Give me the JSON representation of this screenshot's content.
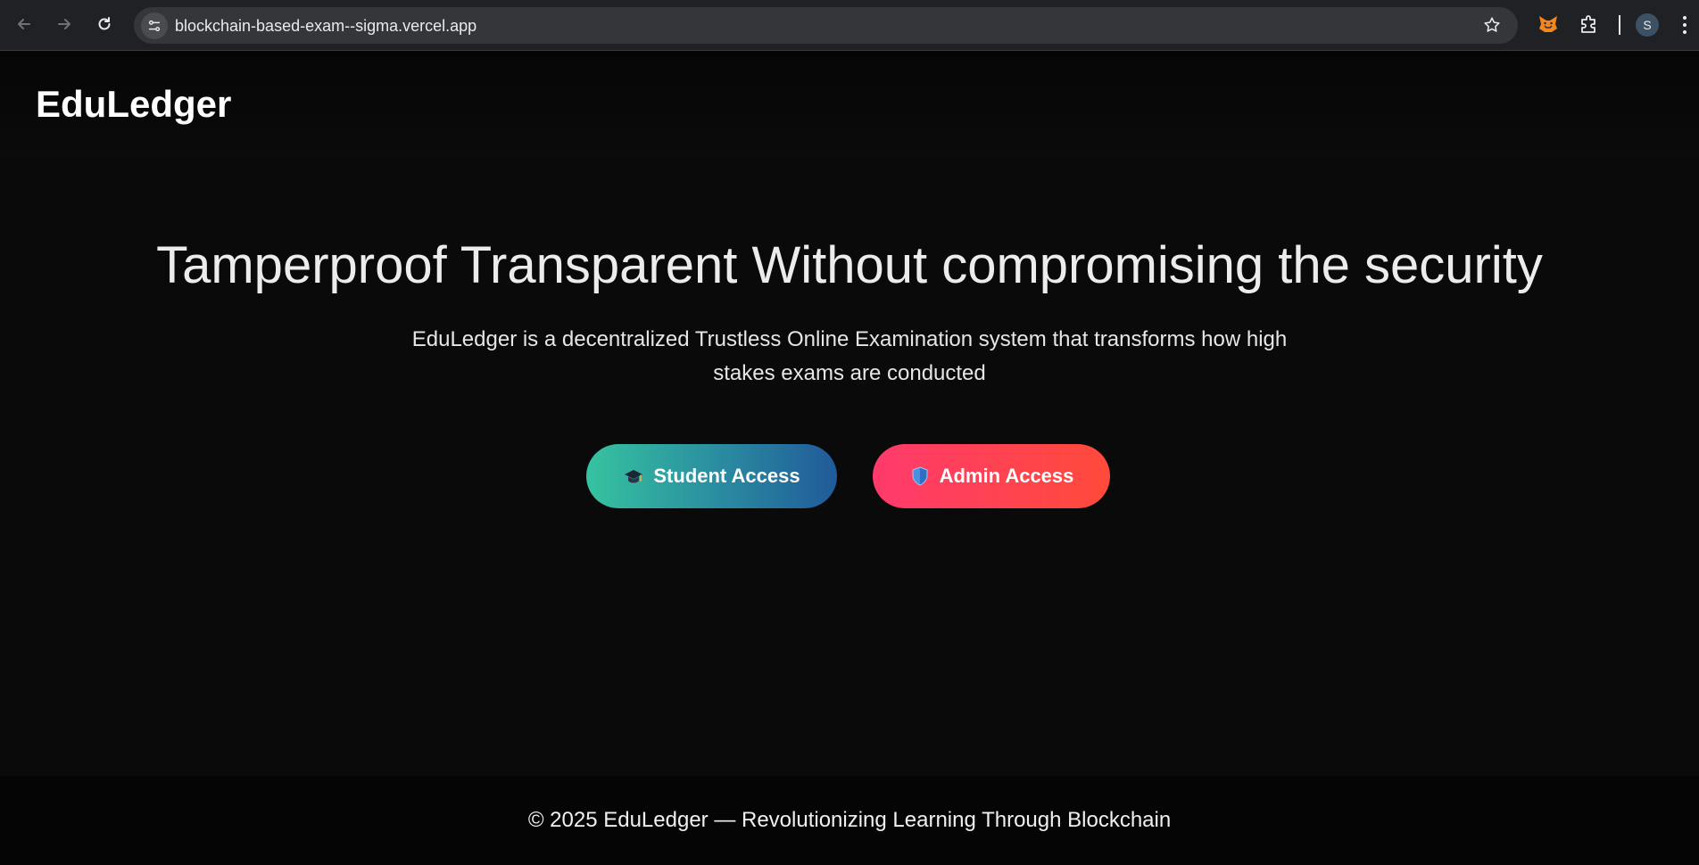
{
  "browser": {
    "url": "blockchain-based-exam--sigma.vercel.app",
    "profile_initial": "S"
  },
  "header": {
    "brand": "EduLedger"
  },
  "hero": {
    "title": "Tamperproof Transparent Without compromising the security",
    "subtitle": "EduLedger is a decentralized Trustless Online Examination system that transforms how high stakes exams are conducted"
  },
  "actions": {
    "student_label": "Student Access",
    "student_icon": "graduation-cap-icon",
    "admin_label": "Admin Access",
    "admin_icon": "shield-icon"
  },
  "footer": {
    "text": "© 2025 EduLedger — Revolutionizing Learning Through Blockchain"
  },
  "colors": {
    "page_bg": "#0a0a0a",
    "student_gradient": [
      "#36c3a0",
      "#205a9a"
    ],
    "admin_gradient": [
      "#ff3a6c",
      "#ff4a3a"
    ]
  }
}
